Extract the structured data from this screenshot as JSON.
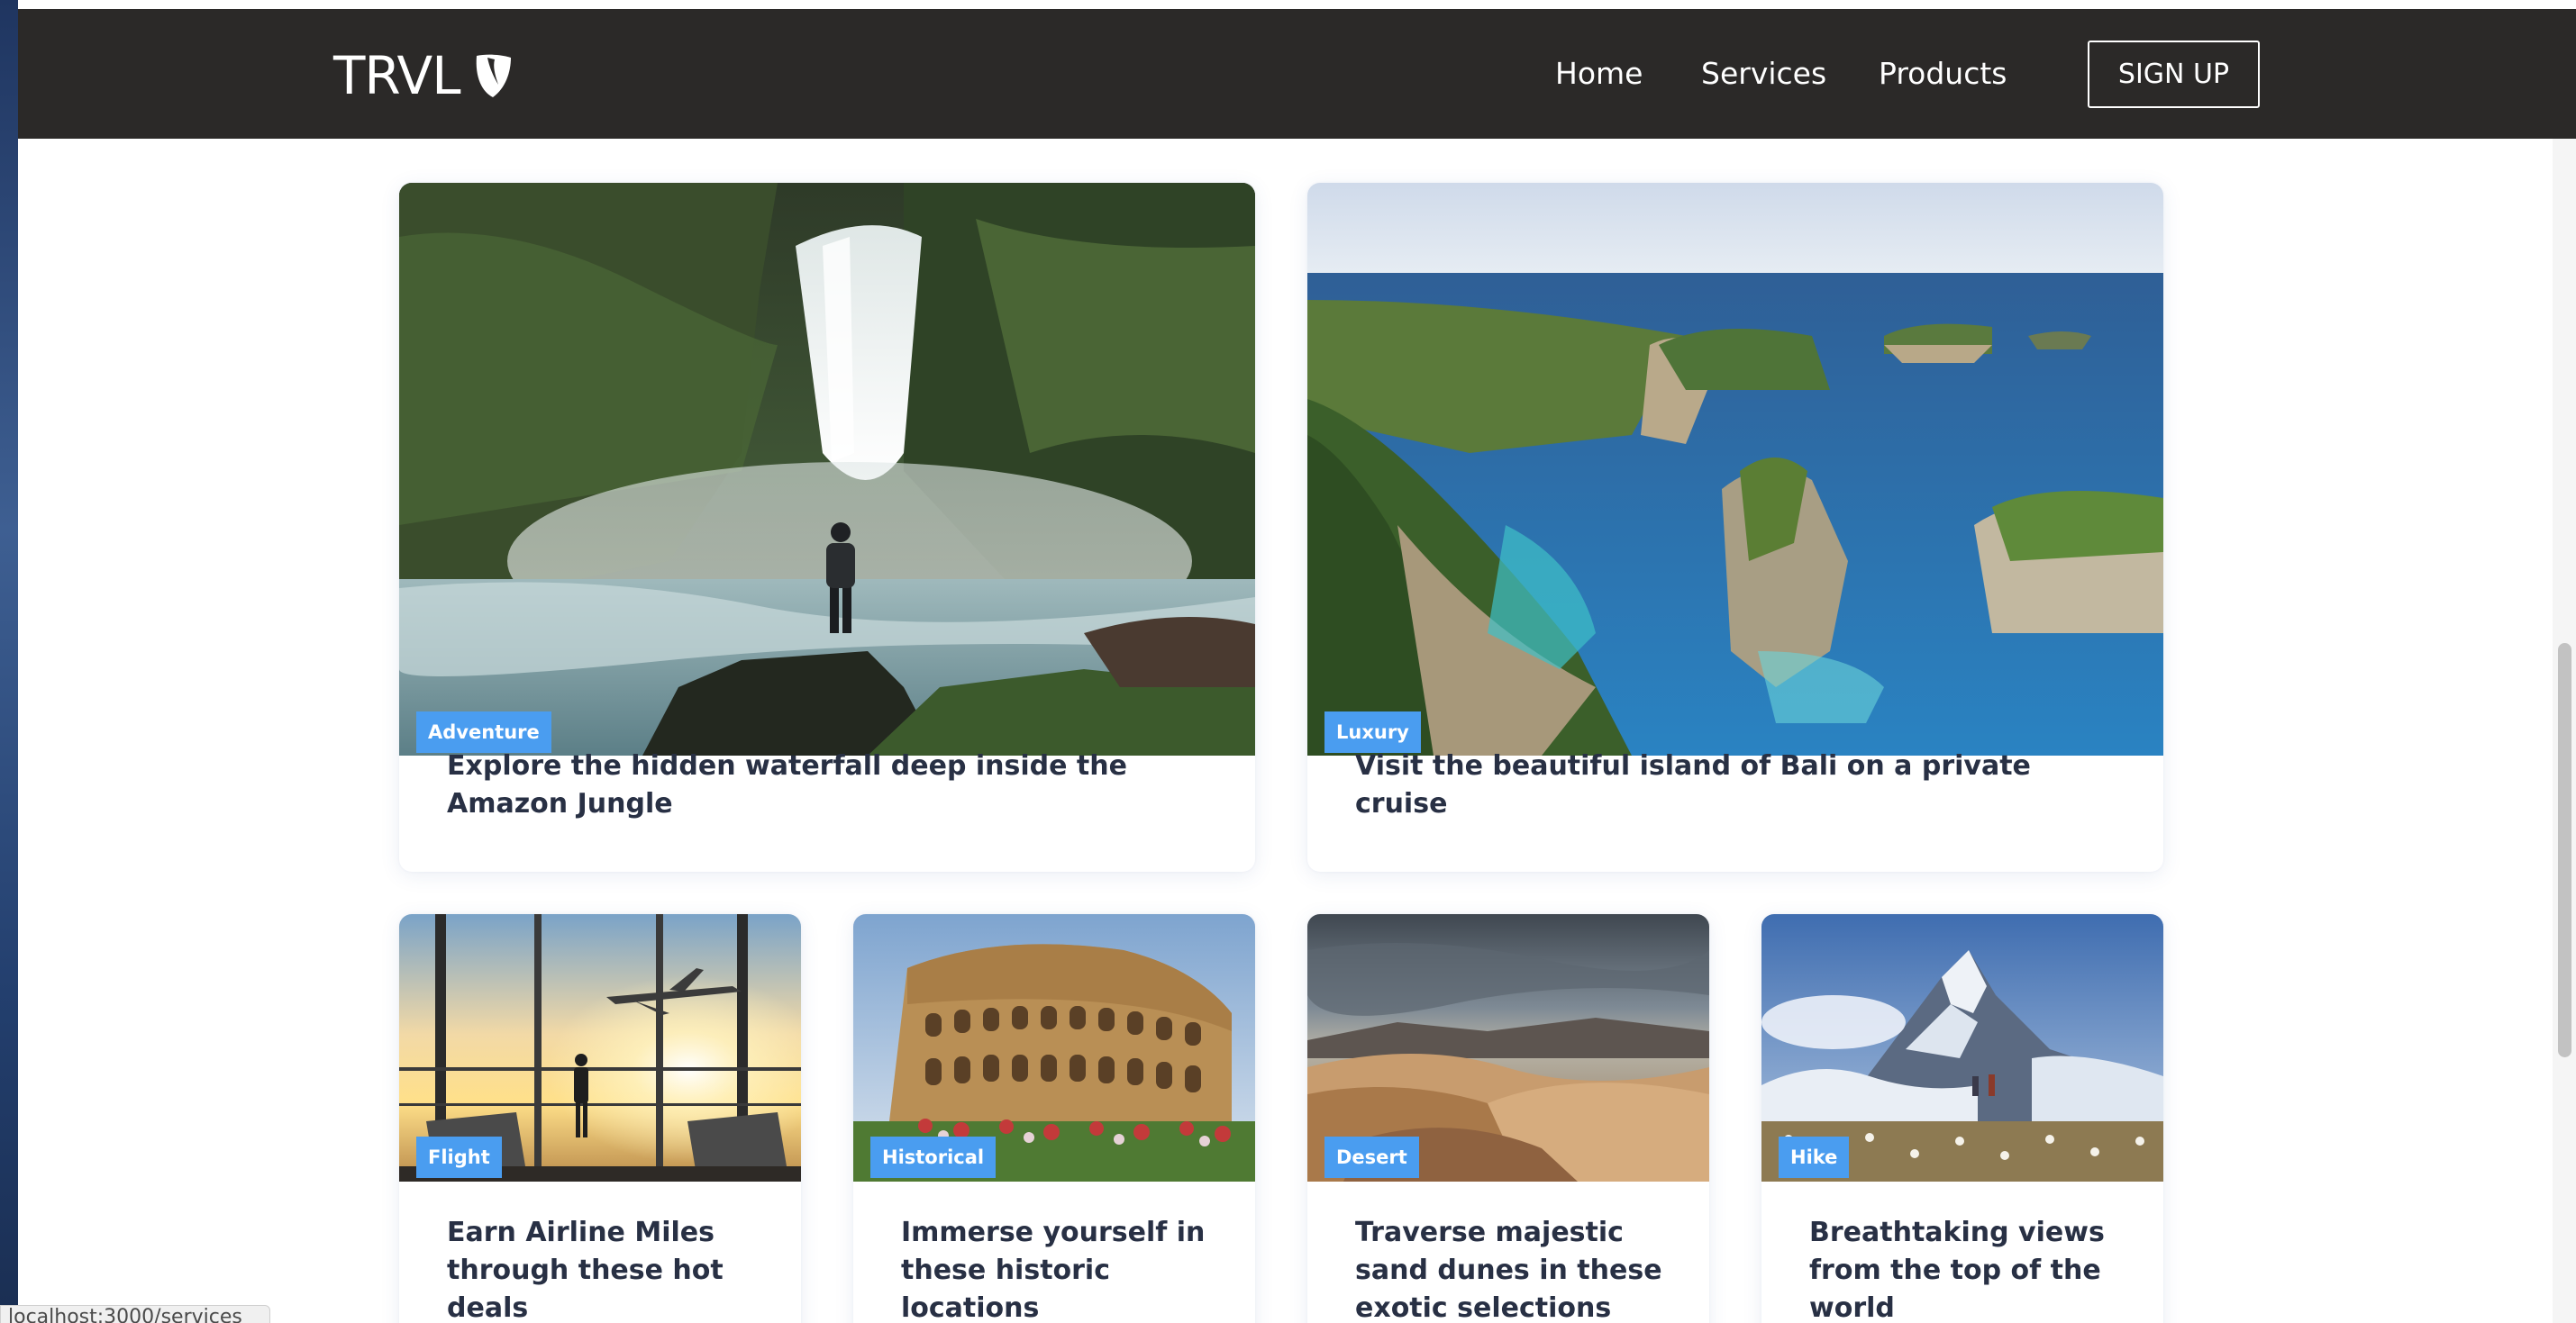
{
  "header": {
    "brand": "TRVL",
    "brand_logo": "typo3-shield-logo",
    "nav": {
      "home": "Home",
      "services": "Services",
      "products": "Products"
    },
    "signup_label": "SIGN UP",
    "background": "#2b2928"
  },
  "cards": [
    {
      "badge": "Adventure",
      "title": "Explore the hidden waterfall deep inside the Amazon Jungle",
      "image": "waterfall-jungle-photo"
    },
    {
      "badge": "Luxury",
      "title": "Visit the beautiful island of Bali on a private cruise",
      "image": "bali-cliffs-photo"
    },
    {
      "badge": "Flight",
      "title": "Earn Airline Miles through these hot deals",
      "image": "airport-sunset-photo"
    },
    {
      "badge": "Historical",
      "title": "Immerse yourself in these historic locations",
      "image": "colosseum-photo"
    },
    {
      "badge": "Desert",
      "title": "Traverse majestic sand dunes in these exotic selections",
      "image": "sand-dunes-photo"
    },
    {
      "badge": "Hike",
      "title": "Breathtaking views from the top of the world",
      "image": "matterhorn-photo"
    }
  ],
  "colors": {
    "badge": "#4a9df0",
    "title": "#283044",
    "accent_border": "#ffffff"
  },
  "status_bar": {
    "url": "localhost:3000/services"
  }
}
